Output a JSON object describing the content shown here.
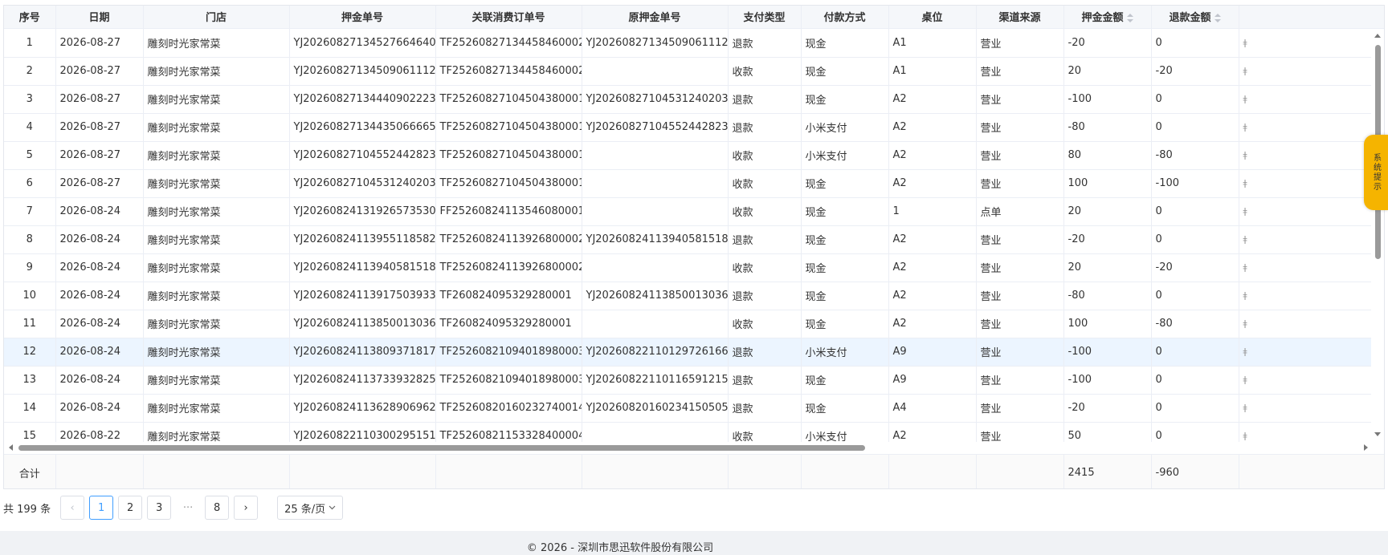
{
  "table": {
    "headers": [
      "序号",
      "日期",
      "门店",
      "押金单号",
      "关联消费订单号",
      "原押金单号",
      "支付类型",
      "付款方式",
      "桌位",
      "渠道来源",
      "押金金额",
      "退款金额"
    ],
    "rows": [
      [
        "1",
        "2026-08-27",
        "雕刻时光家常菜",
        "YJ2026082713452766​4640",
        "TF25260827134458460002",
        "YJ20260827134509061112",
        "退款",
        "现金",
        "A1",
        "营业",
        "-20",
        "0"
      ],
      [
        "2",
        "2026-08-27",
        "雕刻时光家常菜",
        "YJ20260827134509061112",
        "TF25260827134458460002",
        "",
        "收款",
        "现金",
        "A1",
        "营业",
        "20",
        "-20"
      ],
      [
        "3",
        "2026-08-27",
        "雕刻时光家常菜",
        "YJ20260827134440902223",
        "TF25260827104504380001",
        "YJ20260827104531240203",
        "退款",
        "现金",
        "A2",
        "营业",
        "-100",
        "0"
      ],
      [
        "4",
        "2026-08-27",
        "雕刻时光家常菜",
        "YJ20260827134435066665",
        "TF25260827104504380001",
        "YJ20260827104552442823",
        "退款",
        "小米支付",
        "A2",
        "营业",
        "-80",
        "0"
      ],
      [
        "5",
        "2026-08-27",
        "雕刻时光家常菜",
        "YJ20260827104552442823",
        "TF25260827104504380001",
        "",
        "收款",
        "小米支付",
        "A2",
        "营业",
        "80",
        "-80"
      ],
      [
        "6",
        "2026-08-27",
        "雕刻时光家常菜",
        "YJ20260827104531240203",
        "TF25260827104504380001",
        "",
        "收款",
        "现金",
        "A2",
        "营业",
        "100",
        "-100"
      ],
      [
        "7",
        "2026-08-24",
        "雕刻时光家常菜",
        "YJ20260824131926573530",
        "FF25260824113546080001",
        "",
        "收款",
        "现金",
        "1",
        "点单",
        "20",
        "0"
      ],
      [
        "8",
        "2026-08-24",
        "雕刻时光家常菜",
        "YJ20260824113955118582",
        "TF25260824113926800002",
        "YJ20260824113940581518",
        "退款",
        "现金",
        "A2",
        "营业",
        "-20",
        "0"
      ],
      [
        "9",
        "2026-08-24",
        "雕刻时光家常菜",
        "YJ20260824113940581518",
        "TF25260824113926800002",
        "",
        "收款",
        "现金",
        "A2",
        "营业",
        "20",
        "-20"
      ],
      [
        "10",
        "2026-08-24",
        "雕刻时光家常菜",
        "YJ20260824113917503933",
        "TF260824095329280001",
        "YJ20260824113850013036",
        "退款",
        "现金",
        "A2",
        "营业",
        "-80",
        "0"
      ],
      [
        "11",
        "2026-08-24",
        "雕刻时光家常菜",
        "YJ20260824113850013036",
        "TF260824095329280001",
        "",
        "收款",
        "现金",
        "A2",
        "营业",
        "100",
        "-80"
      ],
      [
        "12",
        "2026-08-24",
        "雕刻时光家常菜",
        "YJ20260824113809371817",
        "TF25260821094018980003",
        "YJ20260822110129726166",
        "退款",
        "小米支付",
        "A9",
        "营业",
        "-100",
        "0"
      ],
      [
        "13",
        "2026-08-24",
        "雕刻时光家常菜",
        "YJ20260824113733932825",
        "TF25260821094018980003",
        "YJ20260822110116591215",
        "退款",
        "现金",
        "A9",
        "营业",
        "-100",
        "0"
      ],
      [
        "14",
        "2026-08-24",
        "雕刻时光家常菜",
        "YJ20260824113628906962",
        "TF25260820160232740014",
        "YJ20260820160234150505",
        "退款",
        "现金",
        "A4",
        "营业",
        "-20",
        "0"
      ],
      [
        "15",
        "2026-08-22",
        "雕刻时光家常菜",
        "YJ20260822110300295151",
        "TF25260821153328400004",
        "",
        "收款",
        "小米支付",
        "A2",
        "营业",
        "50",
        "0"
      ]
    ],
    "highlight_row": 11,
    "sum_label": "合计",
    "sum_deposit": "2415",
    "sum_refund": "-960"
  },
  "side_tab": {
    "label": "系统提示"
  },
  "pager": {
    "total": "共 199 条",
    "prev": "‹",
    "next": "›",
    "pages": [
      "1",
      "2",
      "3",
      "8"
    ],
    "more": "···",
    "current": "1",
    "page_size": "25 条/页",
    "dropdown_icon": "chevron-down-icon"
  },
  "footer": {
    "copyright": "© 2026 - 深圳市思迅软件股份有限公司"
  },
  "colors": {
    "accent": "#409eff",
    "highlight": "#ecf5ff",
    "tab": "#f5b400"
  }
}
